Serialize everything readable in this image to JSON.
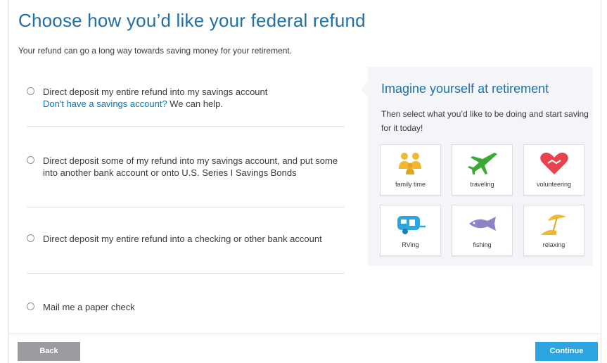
{
  "header": {
    "title": "Choose how you’d like your federal refund",
    "subtitle": "Your refund can go a long way towards saving money for your retirement."
  },
  "options": [
    {
      "label": "Direct deposit my entire refund into my savings account",
      "link": "Don't have a savings account?",
      "after_link": " We can help."
    },
    {
      "label": "Direct deposit some of my refund into my savings account, and put some into another bank account or onto U.S. Series I Savings Bonds"
    },
    {
      "label": "Direct deposit my entire refund into a checking or other bank account"
    },
    {
      "label": "Mail me a paper check"
    }
  ],
  "panel": {
    "title": "Imagine yourself at retirement",
    "text": "Then select what you’d like to be doing and start saving for it today!",
    "tiles": [
      {
        "label": "family time",
        "icon": "family-icon",
        "color": "#f0b72f"
      },
      {
        "label": "traveling",
        "icon": "airplane-icon",
        "color": "#3aaa35"
      },
      {
        "label": "volunteering",
        "icon": "heart-hands-icon",
        "color": "#e8424f"
      },
      {
        "label": "RVing",
        "icon": "rv-trailer-icon",
        "color": "#2ca5e0"
      },
      {
        "label": "fishing",
        "icon": "fish-icon",
        "color": "#8e83c4"
      },
      {
        "label": "relaxing",
        "icon": "beach-umbrella-icon",
        "color": "#f0b72f"
      }
    ]
  },
  "footer": {
    "back_label": "Back",
    "continue_label": "Continue"
  }
}
